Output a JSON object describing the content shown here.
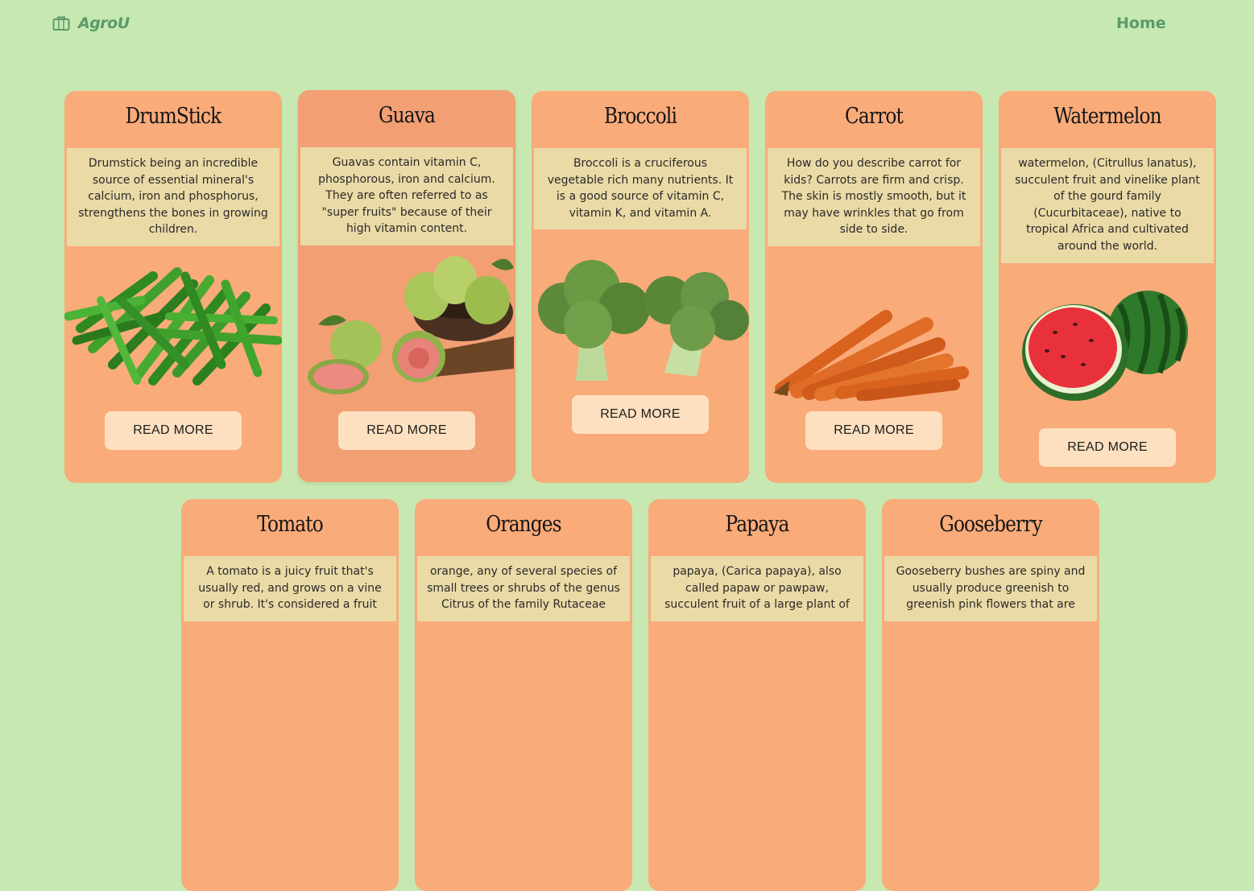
{
  "nav": {
    "brand": "AgroU",
    "home": "Home"
  },
  "cards": [
    {
      "title": "DrumStick",
      "desc": "Drumstick being an incredible source of essential mineral's calcium, iron and phosphorus, strengthens the bones in growing children.",
      "button": "READ MORE"
    },
    {
      "title": "Guava",
      "desc": "Guavas contain vitamin C, phosphorous, iron and calcium. They are often referred to as \"super fruits\" because of their high vitamin content.",
      "button": "READ MORE"
    },
    {
      "title": "Broccoli",
      "desc": "Broccoli is a cruciferous vegetable rich many nutrients. It is a good source of vitamin C, vitamin K, and vitamin A.",
      "button": "READ MORE"
    },
    {
      "title": "Carrot",
      "desc": "How do you describe carrot for kids? Carrots are firm and crisp. The skin is mostly smooth, but it may have wrinkles that go from side to side.",
      "button": "READ MORE"
    },
    {
      "title": "Watermelon",
      "desc": "watermelon, (Citrullus lanatus), succulent fruit and vinelike plant of the gourd family (Cucurbitaceae), native to tropical Africa and cultivated around the world.",
      "button": "READ MORE"
    },
    {
      "title": "Tomato",
      "desc": "A tomato is a juicy fruit that's usually red, and grows on a vine or shrub. It's considered a fruit"
    },
    {
      "title": "Oranges",
      "desc": "orange, any of several species of small trees or shrubs of the genus Citrus of the family Rutaceae"
    },
    {
      "title": "Papaya",
      "desc": "papaya, (Carica papaya), also called papaw or pawpaw, succulent fruit of a large plant of"
    },
    {
      "title": "Gooseberry",
      "desc": "Gooseberry bushes are spiny and usually produce greenish to greenish pink flowers that are"
    }
  ],
  "colors": {
    "background": "#c7e8b1",
    "card": "#f9ab7a",
    "card_hover": "#f29f74",
    "desc_bg": "#eadaa6",
    "button": "#fde0c0",
    "brand": "#5a9a68"
  },
  "icons": {
    "brand": "briefcase-icon"
  },
  "images": [
    "drumstick-image",
    "guava-image",
    "broccoli-image",
    "carrot-image",
    "watermelon-image"
  ]
}
